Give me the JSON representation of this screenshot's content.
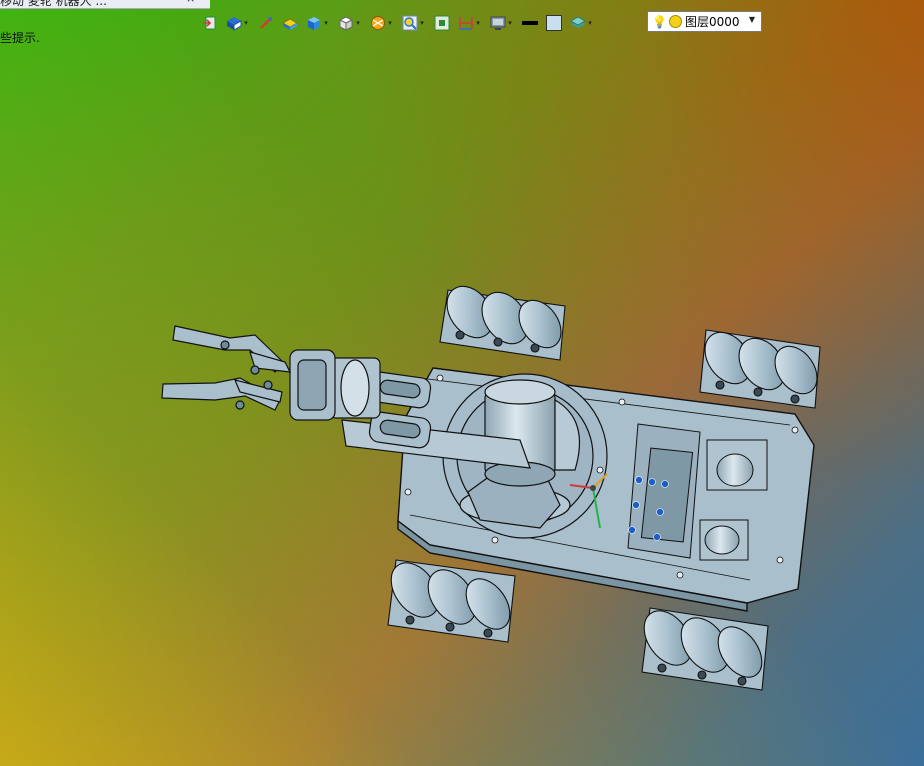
{
  "document_tab": {
    "title": "移动 麦轮 机器人 ...",
    "close_glyph": "×"
  },
  "hint": "些提示.",
  "toolbar": {
    "icons": [
      {
        "name": "exit-sketch-icon"
      },
      {
        "name": "view-orientation-icon",
        "dropdown": true
      },
      {
        "name": "measure-icon"
      },
      {
        "name": "material-icon"
      },
      {
        "name": "display-style-icon",
        "dropdown": true
      },
      {
        "name": "render-mode-icon",
        "dropdown": true
      },
      {
        "name": "section-view-icon",
        "dropdown": true
      },
      {
        "name": "zoom-icon",
        "dropdown": true
      },
      {
        "name": "fit-view-icon"
      },
      {
        "name": "dimension-icon",
        "dropdown": true
      },
      {
        "name": "screen-icon",
        "dropdown": true
      },
      {
        "name": "line-color-icon"
      },
      {
        "name": "fill-color-icon"
      },
      {
        "name": "layer-manager-icon",
        "dropdown": true
      }
    ]
  },
  "layer_select": {
    "value": "图层0000"
  },
  "colors": {
    "model_fill": "#a9bfcc",
    "model_stroke": "#111111",
    "accent_blue": "#1b5ec8"
  }
}
